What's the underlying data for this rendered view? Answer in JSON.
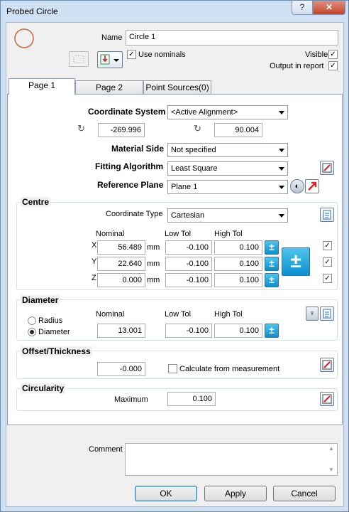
{
  "window": {
    "title": "Probed Circle",
    "help": "?",
    "close": "✕"
  },
  "header": {
    "name_label": "Name",
    "name_value": "Circle 1",
    "use_nominals_label": "Use nominals",
    "use_nominals_checked": "✓",
    "visible_label": "Visible",
    "visible_checked": "✓",
    "output_label": "Output in report",
    "output_checked": "✓"
  },
  "tabs": [
    "Page 1",
    "Page 2",
    "Point Sources(0)"
  ],
  "page1": {
    "coord_system_label": "Coordinate System",
    "coord_system_value": "<Active Alignment>",
    "coord_a": "-269.996",
    "coord_b": "90.004",
    "material_side_label": "Material Side",
    "material_side_value": "Not specified",
    "fitting_label": "Fitting Algorithm",
    "fitting_value": "Least Square",
    "ref_plane_label": "Reference Plane",
    "ref_plane_value": "Plane 1"
  },
  "centre": {
    "title": "Centre",
    "coord_type_label": "Coordinate Type",
    "coord_type_value": "Cartesian",
    "col_nominal": "Nominal",
    "col_low": "Low Tol",
    "col_high": "High Tol",
    "rows": [
      {
        "axis": "X",
        "nominal": "56.489",
        "unit": "mm",
        "low": "-0.100",
        "high": "0.100",
        "checked": "✓"
      },
      {
        "axis": "Y",
        "nominal": "22.640",
        "unit": "mm",
        "low": "-0.100",
        "high": "0.100",
        "checked": "✓"
      },
      {
        "axis": "Z",
        "nominal": "0.000",
        "unit": "mm",
        "low": "-0.100",
        "high": "0.100",
        "checked": "✓"
      }
    ]
  },
  "diameter": {
    "title": "Diameter",
    "radius_label": "Radius",
    "diameter_label": "Diameter",
    "col_nominal": "Nominal",
    "col_low": "Low Tol",
    "col_high": "High Tol",
    "nominal": "13.001",
    "low": "-0.100",
    "high": "0.100"
  },
  "offset": {
    "title": "Offset/Thickness",
    "value": "-0.000",
    "calc_label": "Calculate from measurement"
  },
  "circularity": {
    "title": "Circularity",
    "max_label": "Maximum",
    "max_value": "0.100"
  },
  "comment": {
    "label": "Comment",
    "value": ""
  },
  "buttons": {
    "ok": "OK",
    "apply": "Apply",
    "cancel": "Cancel"
  },
  "colors": {
    "title_bar": "#cfe0f2",
    "circle_icon": "#c06a3a",
    "plus_button": "#0b8fd0"
  }
}
